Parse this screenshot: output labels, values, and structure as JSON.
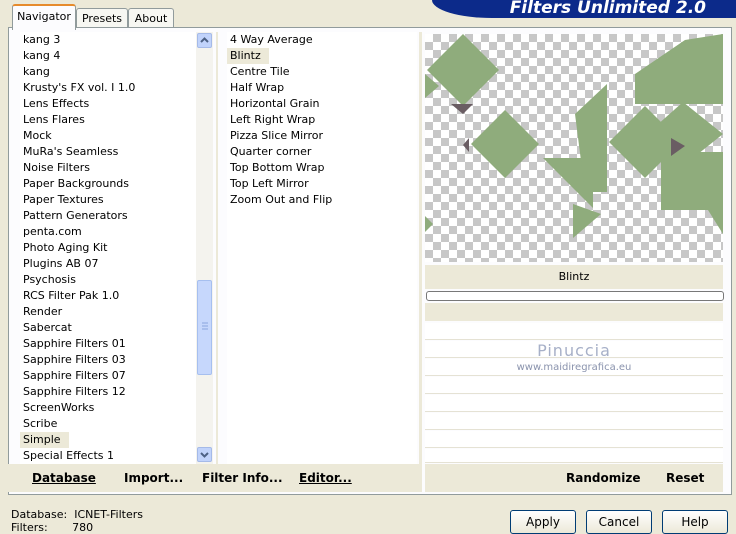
{
  "tabs": [
    {
      "label": "Navigator",
      "active": true
    },
    {
      "label": "Presets",
      "active": false
    },
    {
      "label": "About",
      "active": false
    }
  ],
  "app_title": "Filters Unlimited 2.0",
  "categories": [
    {
      "label": "kang 3"
    },
    {
      "label": "kang 4"
    },
    {
      "label": "kang"
    },
    {
      "label": "Krusty's FX vol. I 1.0"
    },
    {
      "label": "Lens Effects"
    },
    {
      "label": "Lens Flares"
    },
    {
      "label": "Mock"
    },
    {
      "label": "MuRa's Seamless"
    },
    {
      "label": "Noise Filters"
    },
    {
      "label": "Paper Backgrounds"
    },
    {
      "label": "Paper Textures"
    },
    {
      "label": "Pattern Generators"
    },
    {
      "label": "penta.com"
    },
    {
      "label": "Photo Aging Kit"
    },
    {
      "label": "Plugins AB 07"
    },
    {
      "label": "Psychosis"
    },
    {
      "label": "RCS Filter Pak 1.0"
    },
    {
      "label": "Render"
    },
    {
      "label": "Sabercat"
    },
    {
      "label": "Sapphire Filters 01"
    },
    {
      "label": "Sapphire Filters 03"
    },
    {
      "label": "Sapphire Filters 07"
    },
    {
      "label": "Sapphire Filters 12"
    },
    {
      "label": "ScreenWorks"
    },
    {
      "label": "Scribe"
    },
    {
      "label": "Simple",
      "selected": true
    },
    {
      "label": "Special Effects 1"
    }
  ],
  "filters": [
    {
      "label": "4 Way Average"
    },
    {
      "label": "Blintz",
      "selected": true
    },
    {
      "label": "Centre Tile"
    },
    {
      "label": "Half Wrap"
    },
    {
      "label": "Horizontal Grain"
    },
    {
      "label": "Left Right Wrap"
    },
    {
      "label": "Pizza Slice Mirror"
    },
    {
      "label": "Quarter corner"
    },
    {
      "label": "Top Bottom Wrap"
    },
    {
      "label": "Top Left Mirror"
    },
    {
      "label": "Zoom Out and Flip"
    }
  ],
  "selected_filter_name": "Blintz",
  "watermark": {
    "line1": "Pinuccia",
    "line2": "www.maidiregrafica.eu"
  },
  "bottom_buttons": {
    "database": "Database",
    "import": "Import...",
    "filter_info": "Filter Info...",
    "editor": "Editor...",
    "randomize": "Randomize",
    "reset": "Reset"
  },
  "status": {
    "database_label": "Database:",
    "database_value": "ICNET-Filters",
    "filters_label": "Filters:",
    "filters_value": "780"
  },
  "dialog_buttons": {
    "apply": "Apply",
    "cancel": "Cancel",
    "help": "Help"
  },
  "colors": {
    "shape_green": "#8fac7c",
    "shape_dark": "#6a5d63",
    "banner": "#0c2a8a"
  }
}
